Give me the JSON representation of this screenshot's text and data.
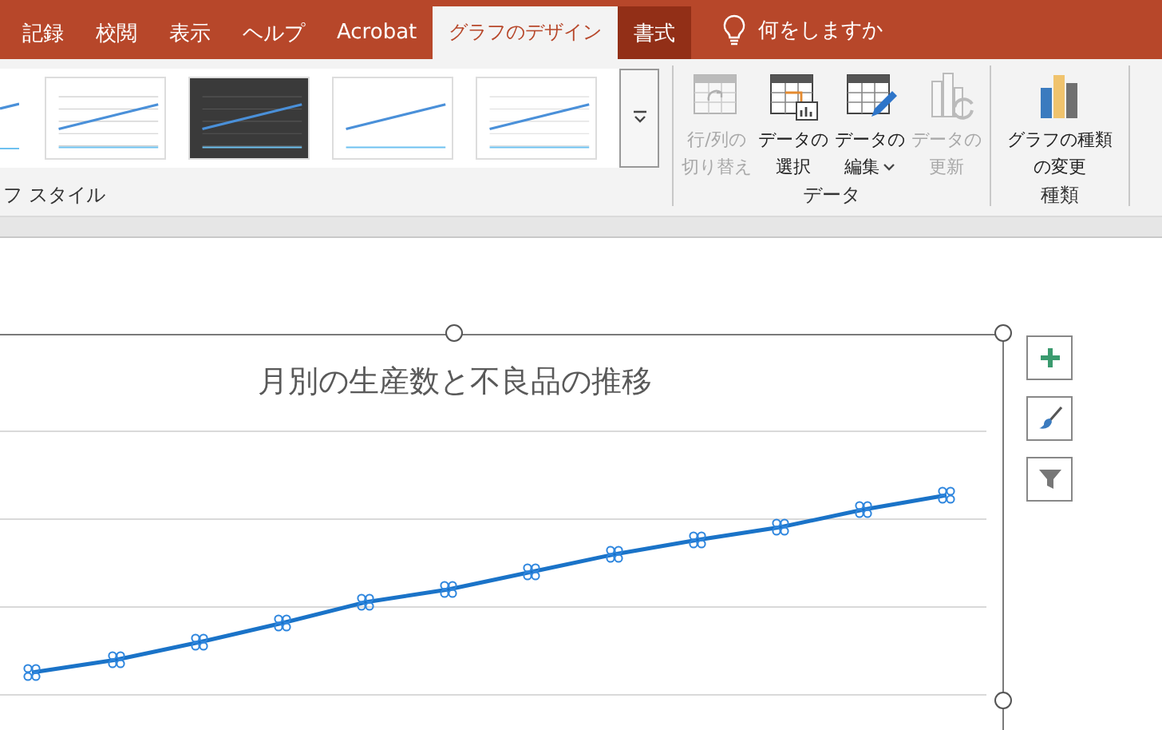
{
  "tabs": [
    {
      "label": "記録",
      "selected": false,
      "contextual": false
    },
    {
      "label": "校閲",
      "selected": false,
      "contextual": false
    },
    {
      "label": "表示",
      "selected": false,
      "contextual": false
    },
    {
      "label": "ヘルプ",
      "selected": false,
      "contextual": false
    },
    {
      "label": "Acrobat",
      "selected": false,
      "contextual": false
    },
    {
      "label": "グラフのデザイン",
      "selected": true,
      "contextual": true
    },
    {
      "label": "書式",
      "selected": false,
      "contextual": true
    }
  ],
  "tell_me": {
    "placeholder": "何をしますか"
  },
  "style_gallery": {
    "label": "フ スタイル",
    "thumbnails": [
      {
        "kind": "partial"
      },
      {
        "kind": "hatched"
      },
      {
        "kind": "dark"
      },
      {
        "kind": "plain"
      },
      {
        "kind": "gridded"
      }
    ]
  },
  "data_group": {
    "label": "データ",
    "buttons": [
      {
        "kind": "switch",
        "lines": [
          "行/列の",
          "切り替え"
        ],
        "disabled": true,
        "dropdown": false
      },
      {
        "kind": "select",
        "lines": [
          "データの",
          "選択"
        ],
        "disabled": false,
        "dropdown": false
      },
      {
        "kind": "edit",
        "lines": [
          "データの",
          "編集"
        ],
        "disabled": false,
        "dropdown": true
      },
      {
        "kind": "refresh",
        "lines": [
          "データの",
          "更新"
        ],
        "disabled": true,
        "dropdown": false
      }
    ]
  },
  "type_group": {
    "label": "種類",
    "buttons": [
      {
        "lines": [
          "グラフの種類",
          "の変更"
        ],
        "disabled": false
      }
    ]
  },
  "chart": {
    "title": "月別の生産数と不良品の推移"
  },
  "chart_tools": [
    {
      "kind": "plus"
    },
    {
      "kind": "brush"
    },
    {
      "kind": "filter"
    }
  ]
}
